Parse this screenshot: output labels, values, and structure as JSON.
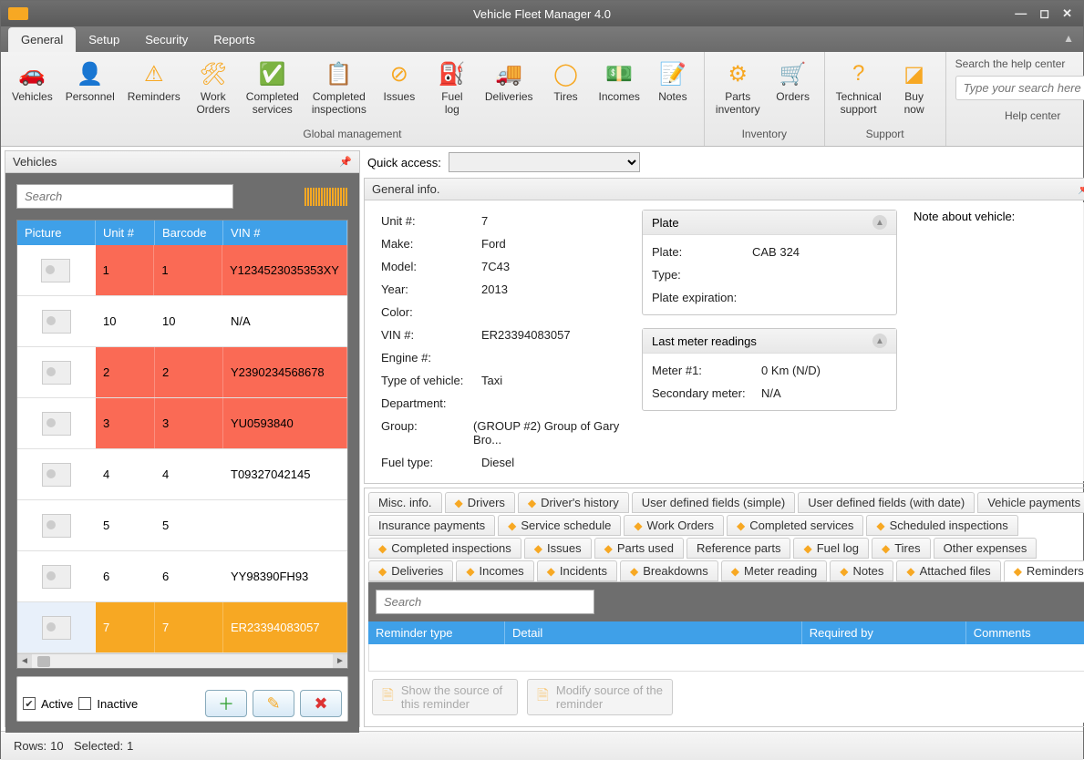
{
  "app": {
    "title": "Vehicle Fleet Manager 4.0"
  },
  "menu": {
    "tabs": [
      "General",
      "Setup",
      "Security",
      "Reports"
    ],
    "active": 0
  },
  "ribbon": {
    "groups": [
      {
        "label": "Global management",
        "items": [
          {
            "name": "vehicles",
            "text": "Vehicles"
          },
          {
            "name": "personnel",
            "text": "Personnel"
          },
          {
            "name": "reminders",
            "text": "Reminders"
          },
          {
            "name": "work-orders",
            "text": "Work\nOrders"
          },
          {
            "name": "completed-services",
            "text": "Completed\nservices"
          },
          {
            "name": "completed-inspections",
            "text": "Completed\ninspections"
          },
          {
            "name": "issues",
            "text": "Issues"
          },
          {
            "name": "fuel-log",
            "text": "Fuel\nlog"
          },
          {
            "name": "deliveries",
            "text": "Deliveries"
          },
          {
            "name": "tires",
            "text": "Tires"
          },
          {
            "name": "incomes",
            "text": "Incomes"
          },
          {
            "name": "notes",
            "text": "Notes"
          }
        ]
      },
      {
        "label": "Inventory",
        "items": [
          {
            "name": "parts-inventory",
            "text": "Parts\ninventory"
          },
          {
            "name": "orders",
            "text": "Orders"
          }
        ]
      },
      {
        "label": "Support",
        "items": [
          {
            "name": "technical-support",
            "text": "Technical\nsupport"
          },
          {
            "name": "buy-now",
            "text": "Buy\nnow"
          }
        ]
      },
      {
        "label": "Help center",
        "search_label": "Search the help center",
        "search_placeholder": "Type your search here"
      }
    ]
  },
  "left": {
    "title": "Vehicles",
    "search_placeholder": "Search",
    "columns": [
      "Picture",
      "Unit #",
      "Barcode",
      "VIN #"
    ],
    "rows": [
      {
        "unit": "1",
        "barcode": "1",
        "vin": "Y1234523035353XY",
        "state": "red"
      },
      {
        "unit": "10",
        "barcode": "10",
        "vin": "N/A",
        "state": ""
      },
      {
        "unit": "2",
        "barcode": "2",
        "vin": "Y2390234568678",
        "state": "red"
      },
      {
        "unit": "3",
        "barcode": "3",
        "vin": "YU0593840",
        "state": "red"
      },
      {
        "unit": "4",
        "barcode": "4",
        "vin": "T09327042145",
        "state": ""
      },
      {
        "unit": "5",
        "barcode": "5",
        "vin": "",
        "state": ""
      },
      {
        "unit": "6",
        "barcode": "6",
        "vin": "YY98390FH93",
        "state": ""
      },
      {
        "unit": "7",
        "barcode": "7",
        "vin": "ER23394083057",
        "state": "sel"
      }
    ],
    "active_label": "Active",
    "inactive_label": "Inactive",
    "active_checked": true,
    "inactive_checked": false
  },
  "quick_access_label": "Quick access:",
  "info": {
    "title": "General info.",
    "fields": {
      "unit_k": "Unit #:",
      "unit_v": "7",
      "make_k": "Make:",
      "make_v": "Ford",
      "model_k": "Model:",
      "model_v": "7C43",
      "year_k": "Year:",
      "year_v": "2013",
      "color_k": "Color:",
      "color_v": "",
      "vin_k": "VIN #:",
      "vin_v": "ER23394083057",
      "engine_k": "Engine #:",
      "engine_v": "",
      "type_k": "Type of vehicle:",
      "type_v": "Taxi",
      "dept_k": "Department:",
      "dept_v": "",
      "group_k": "Group:",
      "group_v": "(GROUP #2) Group of Gary Bro...",
      "fuel_k": "Fuel type:",
      "fuel_v": "Diesel"
    },
    "plate": {
      "title": "Plate",
      "plate_k": "Plate:",
      "plate_v": "CAB 324",
      "type_k": "Type:",
      "type_v": "",
      "exp_k": "Plate expiration:",
      "exp_v": ""
    },
    "meter": {
      "title": "Last meter readings",
      "m1_k": "Meter #1:",
      "m1_v": "0 Km (N/D)",
      "m2_k": "Secondary meter:",
      "m2_v": "N/A"
    },
    "note_label": "Note about vehicle:"
  },
  "tabs": {
    "row1": [
      "Misc. info.",
      "Drivers",
      "Driver's history",
      "User defined fields (simple)",
      "User defined fields (with date)",
      "Vehicle payments"
    ],
    "row2": [
      "Insurance payments",
      "Service schedule",
      "Work Orders",
      "Completed services",
      "Scheduled inspections"
    ],
    "row3": [
      "Completed inspections",
      "Issues",
      "Parts used",
      "Reference parts",
      "Fuel log",
      "Tires",
      "Other expenses"
    ],
    "row4": [
      "Deliveries",
      "Incomes",
      "Incidents",
      "Breakdowns",
      "Meter reading",
      "Notes",
      "Attached files",
      "Reminders"
    ],
    "active": "Reminders"
  },
  "reminders": {
    "search_placeholder": "Search",
    "columns": [
      "Reminder type",
      "Detail",
      "Required by",
      "Comments"
    ],
    "show_source": "Show the source of this reminder",
    "modify_source": "Modify source of the reminder"
  },
  "status": {
    "rows_label": "Rows:",
    "rows": "10",
    "sel_label": "Selected:",
    "sel": "1"
  }
}
